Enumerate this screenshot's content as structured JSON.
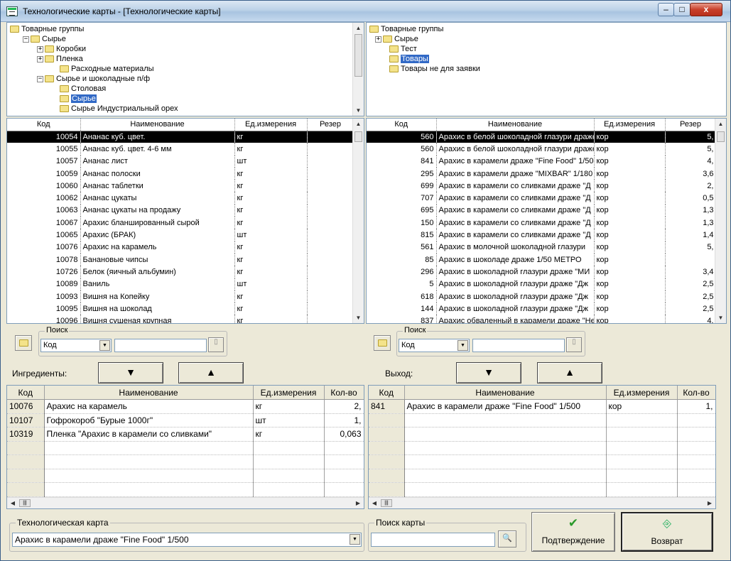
{
  "window": {
    "title": "Технологические карты - [Технологические карты]",
    "min": "–",
    "max": "□",
    "close": "x"
  },
  "left_tree": {
    "items": [
      {
        "label": "Товарные группы",
        "expander": "",
        "selected": false
      },
      {
        "label": "Сырье",
        "expander": "−",
        "selected": false
      },
      {
        "label": "Коробки",
        "expander": "+",
        "selected": false
      },
      {
        "label": "Пленка",
        "expander": "+",
        "selected": false
      },
      {
        "label": "Расходные материалы",
        "expander": "",
        "selected": false
      },
      {
        "label": "Сырье и шоколадные п/ф",
        "expander": "−",
        "selected": false
      },
      {
        "label": "Столовая",
        "expander": "",
        "selected": false
      },
      {
        "label": "Сырье",
        "expander": "",
        "selected": true
      },
      {
        "label": "Сырье Индустриальный орех",
        "expander": "",
        "selected": false
      }
    ]
  },
  "right_tree": {
    "items": [
      {
        "label": "Товарные группы",
        "expander": "",
        "selected": false
      },
      {
        "label": "Сырье",
        "expander": "+",
        "selected": false
      },
      {
        "label": "Тест",
        "expander": "",
        "selected": false
      },
      {
        "label": "Товары",
        "expander": "",
        "selected": true
      },
      {
        "label": "Товары не для заявки",
        "expander": "",
        "selected": false
      }
    ]
  },
  "left_grid": {
    "headers": [
      "Код",
      "Наименование",
      "Ед.измерения",
      "Резер"
    ],
    "rows": [
      [
        "10054",
        "Ананас куб. цвет.",
        "кг",
        ""
      ],
      [
        "10055",
        "Ананас куб. цвет. 4-6 мм",
        "кг",
        ""
      ],
      [
        "10057",
        "Ананас лист",
        "шт",
        ""
      ],
      [
        "10059",
        "Ананас полоски",
        "кг",
        ""
      ],
      [
        "10060",
        "Ананас таблетки",
        "кг",
        ""
      ],
      [
        "10062",
        "Ананас цукаты",
        "кг",
        ""
      ],
      [
        "10063",
        "Ананас цукаты на продажу",
        "кг",
        ""
      ],
      [
        "10067",
        "Арахис бланшированный сырой",
        "кг",
        ""
      ],
      [
        "10065",
        "Арахис (БРАК)",
        "шт",
        ""
      ],
      [
        "10076",
        "Арахис на карамель",
        "кг",
        ""
      ],
      [
        "10078",
        "Банановые чипсы",
        "кг",
        ""
      ],
      [
        "10726",
        "Белок (яичный альбумин)",
        "кг",
        ""
      ],
      [
        "10089",
        "Ваниль",
        "шт",
        ""
      ],
      [
        "10093",
        "Вишня на Копейку",
        "кг",
        ""
      ],
      [
        "10095",
        "Вишня на шоколад",
        "кг",
        ""
      ],
      [
        "10096",
        "Вишня сушеная крупная",
        "кг",
        ""
      ]
    ]
  },
  "right_grid": {
    "headers": [
      "Код",
      "Наименование",
      "Ед.измерения",
      "Резер"
    ],
    "rows": [
      [
        "560",
        "Арахис в белой шоколадной глазури драже",
        "кор",
        "5,"
      ],
      [
        "560",
        "Арахис в белой шоколадной глазури драже",
        "кор",
        "5,"
      ],
      [
        "841",
        "Арахис в карамели драже \"Fine Food\" 1/500",
        "кор",
        "4,"
      ],
      [
        "295",
        "Арахис в карамели драже \"MIXBAR\" 1/180",
        "кор",
        "3,6"
      ],
      [
        "699",
        "Арахис в карамели со сливками драже \"Д",
        "кор",
        "2,"
      ],
      [
        "707",
        "Арахис в карамели со сливками драже \"Д",
        "кор",
        "0,5"
      ],
      [
        "695",
        "Арахис в карамели со сливками драже \"Д",
        "кор",
        "1,3"
      ],
      [
        "150",
        "Арахис в карамели со сливками драже \"Д",
        "кор",
        "1,3"
      ],
      [
        "815",
        "Арахис в карамели со сливками драже \"Д",
        "кор",
        "1,4"
      ],
      [
        "561",
        "Арахис в молочной шоколадной глазури",
        "кор",
        "5,"
      ],
      [
        "85",
        "Арахис в шоколаде драже 1/50 МЕТРО",
        "кор",
        ""
      ],
      [
        "296",
        "Арахис в шоколадной глазури драже \"МИ",
        "кор",
        "3,4"
      ],
      [
        "5",
        "Арахис в шоколадной глазури драже \"Дж",
        "кор",
        "2,5"
      ],
      [
        "618",
        "Арахис в шоколадной глазури драже \"Дж",
        "кор",
        "2,5"
      ],
      [
        "144",
        "Арахис в шоколадной глазури драже \"Дж",
        "кор",
        "2,5"
      ],
      [
        "837",
        "Арахис обваленный в карамели драже \"Не",
        "кор",
        "4,"
      ]
    ]
  },
  "search_left": {
    "title": "Поиск",
    "field": "Код",
    "value": ""
  },
  "search_right": {
    "title": "Поиск",
    "field": "Код",
    "value": ""
  },
  "ingredients": {
    "label": "Ингредиенты:",
    "down": "▼",
    "up": "▲",
    "headers": [
      "Код",
      "Наименование",
      "Ед.измерения",
      "Кол-во"
    ],
    "rows": [
      [
        "10076",
        "Арахис на карамель",
        "кг",
        "2,"
      ],
      [
        "10107",
        "Гофрокороб \"Бурые 1000г\"",
        "шт",
        "1,"
      ],
      [
        "10319",
        "Пленка \"Арахис в карамели со сливками\"",
        "кг",
        "0,063"
      ]
    ]
  },
  "output": {
    "label": "Выход:",
    "down": "▼",
    "up": "▲",
    "headers": [
      "Код",
      "Наименование",
      "Ед.измерения",
      "Кол-во"
    ],
    "rows": [
      [
        "841",
        "Арахис в карамели драже \"Fine Food\" 1/500",
        "кор",
        "1,"
      ]
    ]
  },
  "tech_card": {
    "title": "Технологическая карта",
    "value": "Арахис в карамели драже \"Fine Food\" 1/500"
  },
  "card_search": {
    "title": "Поиск карты",
    "value": ""
  },
  "confirm_label": "Подтверждение",
  "return_label": "Возврат"
}
